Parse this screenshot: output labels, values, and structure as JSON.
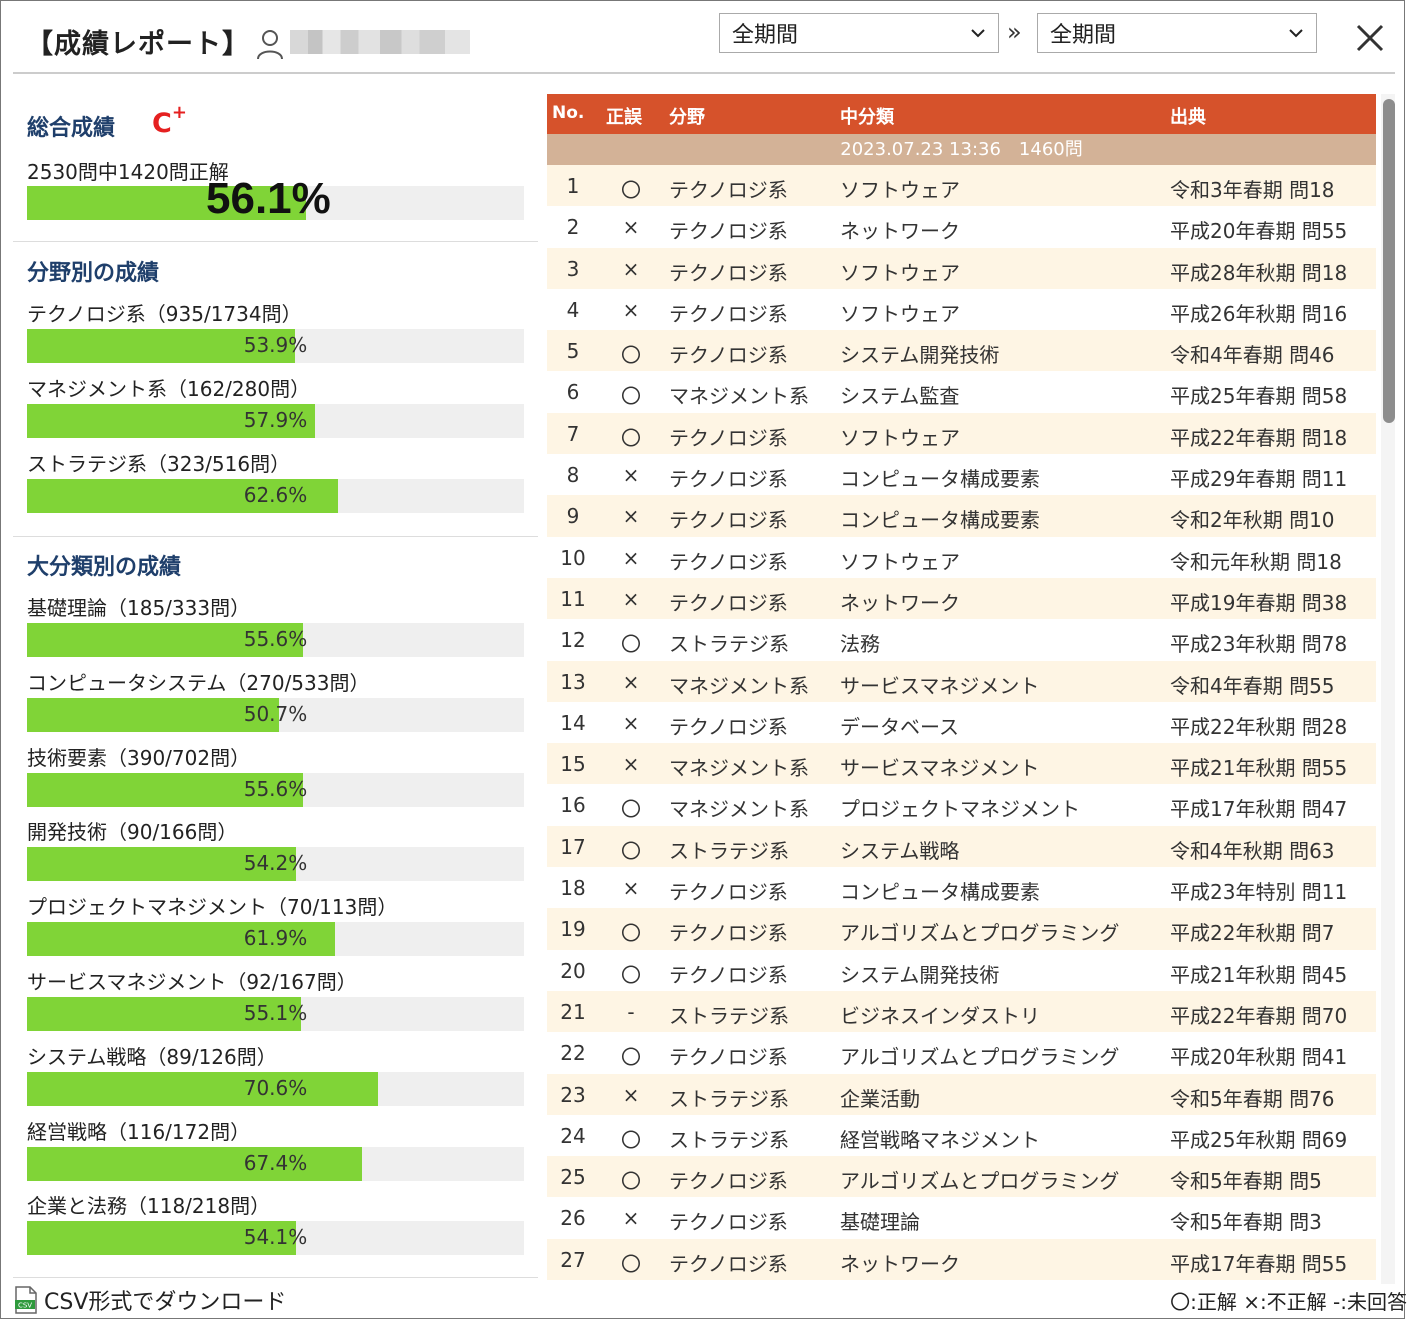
{
  "header": {
    "title": "【成績レポート】",
    "period_from": "全期間",
    "period_separator": "»",
    "period_to": "全期間"
  },
  "overall": {
    "title": "総合成績",
    "grade": "C",
    "grade_suffix": "+",
    "summary": "2530問中1420問正解",
    "percent_text": "56.1%",
    "percent": 56.1
  },
  "field_section": {
    "title": "分野別の成績",
    "items": [
      {
        "label": "テクノロジ系（935/1734問）",
        "pct_text": "53.9%",
        "pct": 53.9
      },
      {
        "label": "マネジメント系（162/280問）",
        "pct_text": "57.9%",
        "pct": 57.9
      },
      {
        "label": "ストラテジ系（323/516問）",
        "pct_text": "62.6%",
        "pct": 62.6
      }
    ]
  },
  "major_section": {
    "title": "大分類別の成績",
    "items": [
      {
        "label": "基礎理論（185/333問）",
        "pct_text": "55.6%",
        "pct": 55.6
      },
      {
        "label": "コンピュータシステム（270/533問）",
        "pct_text": "50.7%",
        "pct": 50.7
      },
      {
        "label": "技術要素（390/702問）",
        "pct_text": "55.6%",
        "pct": 55.6
      },
      {
        "label": "開発技術（90/166問）",
        "pct_text": "54.2%",
        "pct": 54.2
      },
      {
        "label": "プロジェクトマネジメント（70/113問）",
        "pct_text": "61.9%",
        "pct": 61.9
      },
      {
        "label": "サービスマネジメント（92/167問）",
        "pct_text": "55.1%",
        "pct": 55.1
      },
      {
        "label": "システム戦略（89/126問）",
        "pct_text": "70.6%",
        "pct": 70.6
      },
      {
        "label": "経営戦略（116/172問）",
        "pct_text": "67.4%",
        "pct": 67.4
      },
      {
        "label": "企業と法務（118/218問）",
        "pct_text": "54.1%",
        "pct": 54.1
      }
    ]
  },
  "table": {
    "headers": {
      "no": "No.",
      "mark": "正誤",
      "field": "分野",
      "mid": "中分類",
      "source": "出典"
    },
    "session": "2023.07.23 13:36　1460問",
    "rows": [
      {
        "no": "1",
        "mark": "〇",
        "field": "テクノロジ系",
        "mid": "ソフトウェア",
        "source": "令和3年春期 問18"
      },
      {
        "no": "2",
        "mark": "×",
        "field": "テクノロジ系",
        "mid": "ネットワーク",
        "source": "平成20年春期 問55"
      },
      {
        "no": "3",
        "mark": "×",
        "field": "テクノロジ系",
        "mid": "ソフトウェア",
        "source": "平成28年秋期 問18"
      },
      {
        "no": "4",
        "mark": "×",
        "field": "テクノロジ系",
        "mid": "ソフトウェア",
        "source": "平成26年秋期 問16"
      },
      {
        "no": "5",
        "mark": "〇",
        "field": "テクノロジ系",
        "mid": "システム開発技術",
        "source": "令和4年春期 問46"
      },
      {
        "no": "6",
        "mark": "〇",
        "field": "マネジメント系",
        "mid": "システム監査",
        "source": "平成25年春期 問58"
      },
      {
        "no": "7",
        "mark": "〇",
        "field": "テクノロジ系",
        "mid": "ソフトウェア",
        "source": "平成22年春期 問18"
      },
      {
        "no": "8",
        "mark": "×",
        "field": "テクノロジ系",
        "mid": "コンピュータ構成要素",
        "source": "平成29年春期 問11"
      },
      {
        "no": "9",
        "mark": "×",
        "field": "テクノロジ系",
        "mid": "コンピュータ構成要素",
        "source": "令和2年秋期 問10"
      },
      {
        "no": "10",
        "mark": "×",
        "field": "テクノロジ系",
        "mid": "ソフトウェア",
        "source": "令和元年秋期 問18"
      },
      {
        "no": "11",
        "mark": "×",
        "field": "テクノロジ系",
        "mid": "ネットワーク",
        "source": "平成19年春期 問38"
      },
      {
        "no": "12",
        "mark": "〇",
        "field": "ストラテジ系",
        "mid": "法務",
        "source": "平成23年秋期 問78"
      },
      {
        "no": "13",
        "mark": "×",
        "field": "マネジメント系",
        "mid": "サービスマネジメント",
        "source": "令和4年春期 問55"
      },
      {
        "no": "14",
        "mark": "×",
        "field": "テクノロジ系",
        "mid": "データベース",
        "source": "平成22年秋期 問28"
      },
      {
        "no": "15",
        "mark": "×",
        "field": "マネジメント系",
        "mid": "サービスマネジメント",
        "source": "平成21年秋期 問55"
      },
      {
        "no": "16",
        "mark": "〇",
        "field": "マネジメント系",
        "mid": "プロジェクトマネジメント",
        "source": "平成17年秋期 問47"
      },
      {
        "no": "17",
        "mark": "〇",
        "field": "ストラテジ系",
        "mid": "システム戦略",
        "source": "令和4年秋期 問63"
      },
      {
        "no": "18",
        "mark": "×",
        "field": "テクノロジ系",
        "mid": "コンピュータ構成要素",
        "source": "平成23年特別 問11"
      },
      {
        "no": "19",
        "mark": "〇",
        "field": "テクノロジ系",
        "mid": "アルゴリズムとプログラミング",
        "source": "平成22年秋期 問7"
      },
      {
        "no": "20",
        "mark": "〇",
        "field": "テクノロジ系",
        "mid": "システム開発技術",
        "source": "平成21年秋期 問45"
      },
      {
        "no": "21",
        "mark": "-",
        "field": "ストラテジ系",
        "mid": "ビジネスインダストリ",
        "source": "平成22年春期 問70"
      },
      {
        "no": "22",
        "mark": "〇",
        "field": "テクノロジ系",
        "mid": "アルゴリズムとプログラミング",
        "source": "平成20年秋期 問41"
      },
      {
        "no": "23",
        "mark": "×",
        "field": "ストラテジ系",
        "mid": "企業活動",
        "source": "令和5年春期 問76"
      },
      {
        "no": "24",
        "mark": "〇",
        "field": "ストラテジ系",
        "mid": "経営戦略マネジメント",
        "source": "平成25年秋期 問69"
      },
      {
        "no": "25",
        "mark": "〇",
        "field": "テクノロジ系",
        "mid": "アルゴリズムとプログラミング",
        "source": "令和5年春期 問5"
      },
      {
        "no": "26",
        "mark": "×",
        "field": "テクノロジ系",
        "mid": "基礎理論",
        "source": "令和5年春期 問3"
      },
      {
        "no": "27",
        "mark": "〇",
        "field": "テクノロジ系",
        "mid": "ネットワーク",
        "source": "平成17年春期 問55"
      }
    ]
  },
  "footer": {
    "csv_label": "CSV形式でダウンロード",
    "csv_icon_text": "CSV",
    "legend": "〇:正解 ×:不正解 -:未回答"
  },
  "colors": {
    "header_accent": "#d6522b",
    "session_row": "#d3b297",
    "bar_fill": "#80d437",
    "grade": "#e52020",
    "section_title": "#1f3f6b"
  }
}
